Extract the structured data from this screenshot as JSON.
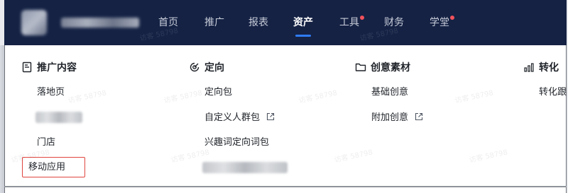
{
  "nav": {
    "menu": [
      {
        "label": "首页",
        "active": false,
        "badge": false
      },
      {
        "label": "推广",
        "active": false,
        "badge": false
      },
      {
        "label": "报表",
        "active": false,
        "badge": false
      },
      {
        "label": "资产",
        "active": true,
        "badge": false
      },
      {
        "label": "工具",
        "active": false,
        "badge": true
      },
      {
        "label": "财务",
        "active": false,
        "badge": false
      },
      {
        "label": "学堂",
        "active": false,
        "badge": true
      }
    ],
    "watermark": "访客 58798"
  },
  "dropdown": {
    "columns": [
      {
        "title": "推广内容",
        "icon": "document-icon",
        "items": [
          {
            "label": "落地页"
          },
          {
            "label": ""
          },
          {
            "label": "门店"
          },
          {
            "label": "移动应用",
            "highlighted": true
          }
        ]
      },
      {
        "title": "定向",
        "icon": "target-icon",
        "items": [
          {
            "label": "定向包"
          },
          {
            "label": "自定义人群包",
            "external": true
          },
          {
            "label": "兴趣词定向词包"
          },
          {
            "label": ""
          }
        ]
      },
      {
        "title": "创意素材",
        "icon": "folder-icon",
        "items": [
          {
            "label": "基础创意"
          },
          {
            "label": "附加创意",
            "external": true
          }
        ]
      },
      {
        "title": "转化",
        "icon": "bar-chart-icon",
        "items": [
          {
            "label": "转化跟"
          }
        ]
      }
    ]
  },
  "colors": {
    "nav_bg": "#152244",
    "accent": "#2f7cf6",
    "badge": "#f2525c",
    "highlight": "#e0443e"
  }
}
